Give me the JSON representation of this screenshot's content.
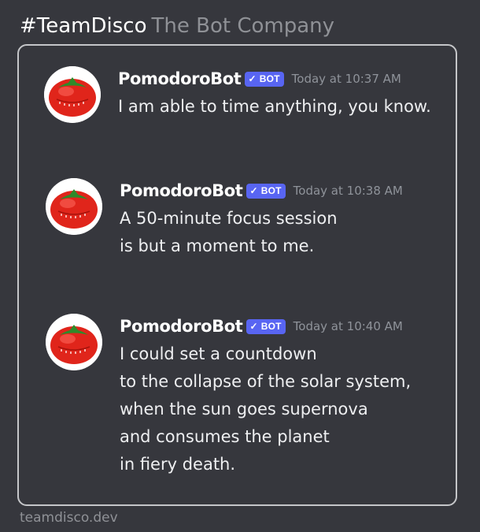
{
  "header": {
    "tag": "#TeamDisco",
    "company": "The Bot Company"
  },
  "messages": [
    {
      "author": "PomodoroBot",
      "badge": "BOT",
      "timestamp": "Today at 10:37 AM",
      "lines": [
        "I am able to time anything, you know."
      ]
    },
    {
      "author": "PomodoroBot",
      "badge": "BOT",
      "timestamp": "Today at 10:38 AM",
      "lines": [
        "A 50-minute focus session",
        "is but a moment to me."
      ]
    },
    {
      "author": "PomodoroBot",
      "badge": "BOT",
      "timestamp": "Today at 10:40 AM",
      "lines": [
        "I could set a countdown",
        "to the collapse of the solar system,",
        "when the sun goes supernova",
        "and consumes the planet",
        "in fiery death."
      ]
    }
  ],
  "footer": {
    "url": "teamdisco.dev"
  },
  "colors": {
    "background": "#36373d",
    "card_border": "#c5c6c9",
    "bot_badge": "#5865f2",
    "tomato": "#e0251b"
  },
  "icons": {
    "avatar": "tomato-timer-icon",
    "badge": "check-icon"
  }
}
